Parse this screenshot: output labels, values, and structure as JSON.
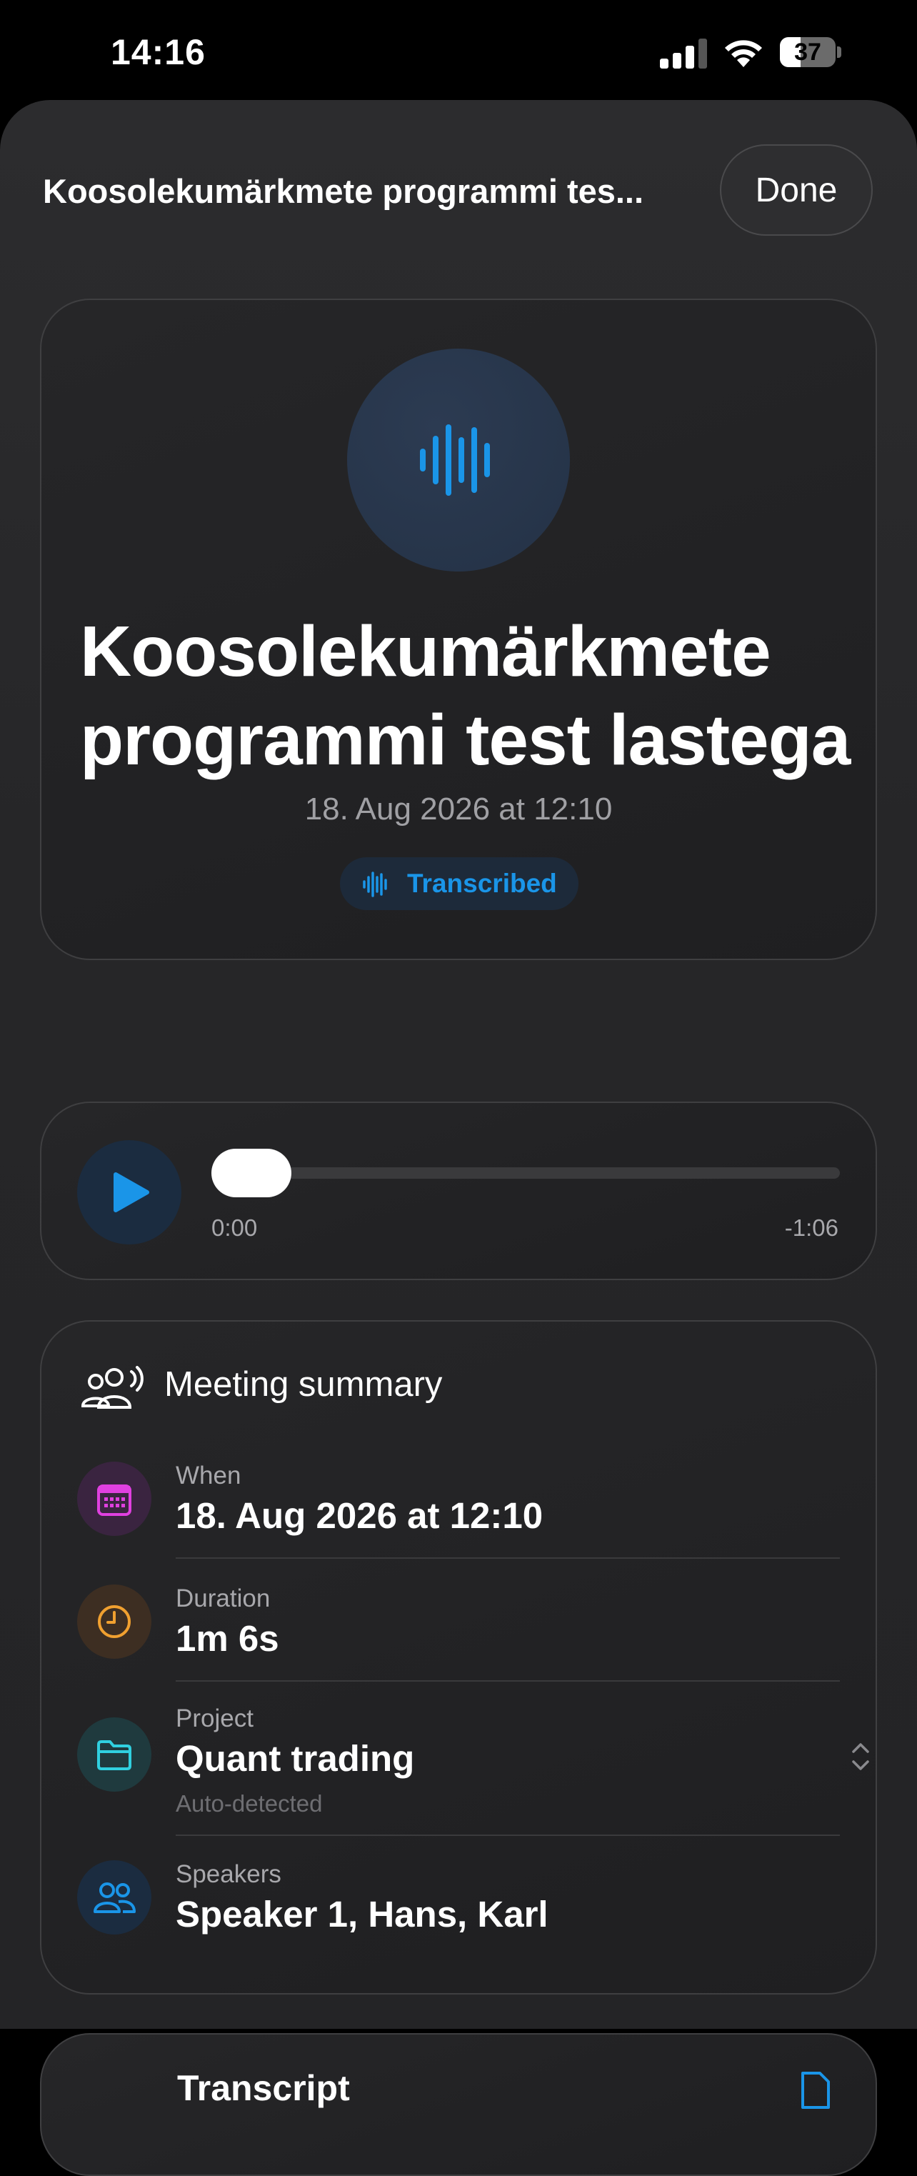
{
  "status_bar": {
    "time": "14:16",
    "battery": "37",
    "battery_level": 0.37
  },
  "header": {
    "title": "Koosolekumärkmete programmi tes...",
    "done_label": "Done"
  },
  "recording": {
    "icon": "waveform-icon",
    "title": "Koosolekumärkmete programmi test lastega",
    "date": "18. Aug 2026 at 12:10",
    "status": "Transcribed"
  },
  "player": {
    "elapsed": "0:00",
    "remaining": "-1:06",
    "progress": 0.0
  },
  "summary": {
    "title": "Meeting summary",
    "rows": [
      {
        "label": "When",
        "value": "18. Aug 2026 at 12:10",
        "icon": "calendar-icon",
        "color": "#e040e0"
      },
      {
        "label": "Duration",
        "value": "1m 6s",
        "icon": "clock-icon",
        "color": "#f0a030"
      },
      {
        "label": "Project",
        "value": "Quant trading",
        "sub": "Auto-detected",
        "icon": "folder-icon",
        "color": "#30d0e0"
      },
      {
        "label": "Speakers",
        "value": "Speaker 1, Hans, Karl",
        "icon": "people-icon",
        "color": "#1a95e8"
      }
    ]
  },
  "transcript": {
    "title": "Transcript"
  },
  "colors": {
    "accent": "#1a95e8",
    "background": "#000000",
    "card": "#1f1f21"
  }
}
